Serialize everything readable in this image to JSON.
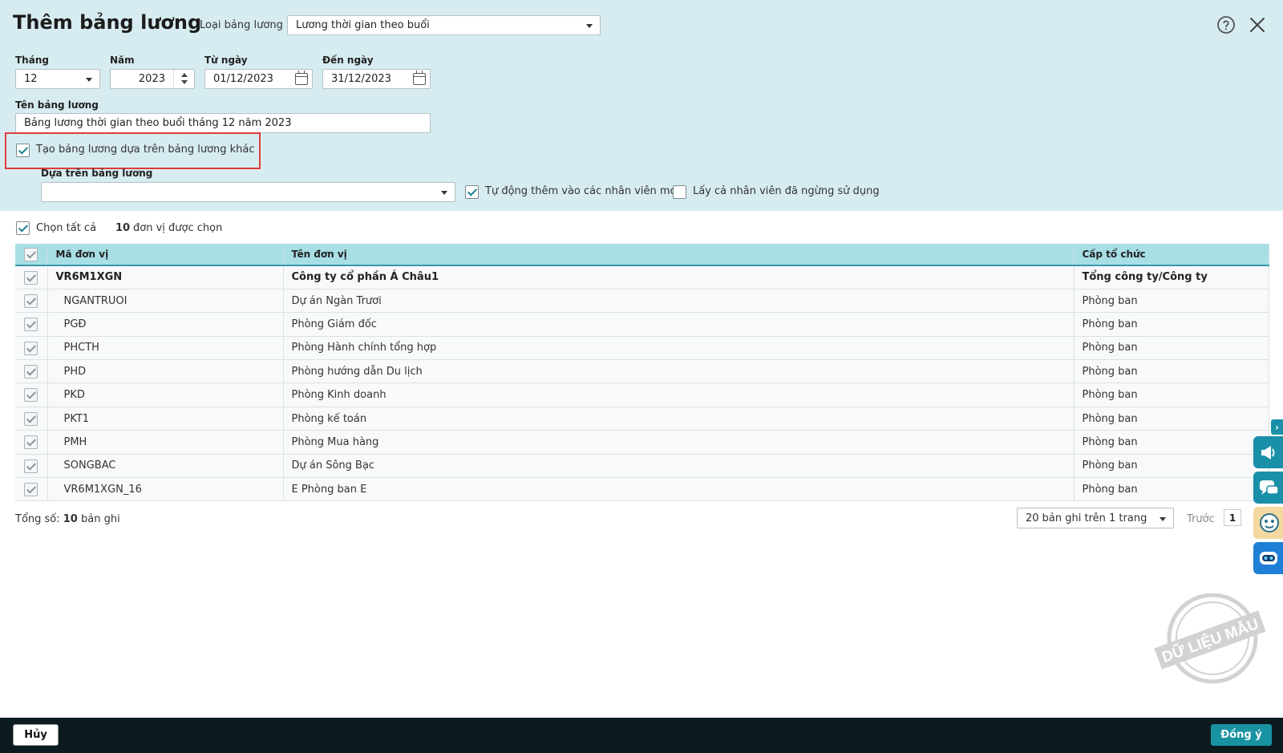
{
  "header": {
    "title": "Thêm bảng lương",
    "payroll_type_label": "Loại bảng lương",
    "payroll_type_value": "Lương thời gian theo buổi"
  },
  "period": {
    "month_label": "Tháng",
    "month_value": "12",
    "year_label": "Năm",
    "year_value": "2023",
    "from_label": "Từ ngày",
    "from_value": "01/12/2023",
    "to_label": "Đến ngày",
    "to_value": "31/12/2023"
  },
  "payroll_name": {
    "label": "Tên bảng lương",
    "value": "Bảng lương thời gian theo buổi tháng 12 năm 2023"
  },
  "options": {
    "based_on_other_label": "Tạo bảng lương dựa trên bảng lương khác",
    "based_on_other_checked": true,
    "based_on_label": "Dựa trên bảng lương",
    "based_on_value": "",
    "auto_add_label": "Tự động thêm vào các nhân viên mới",
    "auto_add_checked": true,
    "include_inactive_label": "Lấy cả nhân viên đã ngừng sử dụng",
    "include_inactive_checked": false
  },
  "selection": {
    "select_all_label": "Chọn tất cả",
    "count": "10",
    "count_suffix": "đơn vị được chọn"
  },
  "table": {
    "columns": [
      "Mã đơn vị",
      "Tên đơn vị",
      "Cấp tổ chức"
    ],
    "rows": [
      {
        "code": "VR6M1XGN",
        "name": "Công ty cổ phần Á Châu1",
        "level": "Tổng công ty/Công ty"
      },
      {
        "code": "NGANTRUOI",
        "name": "Dự án Ngàn Trươi",
        "level": "Phòng ban"
      },
      {
        "code": "PGĐ",
        "name": "Phòng Giám đốc",
        "level": "Phòng ban"
      },
      {
        "code": "PHCTH",
        "name": "Phòng Hành chính tổng hợp",
        "level": "Phòng ban"
      },
      {
        "code": "PHD",
        "name": "Phòng hướng dẫn Du lịch",
        "level": "Phòng ban"
      },
      {
        "code": "PKD",
        "name": "Phòng Kinh doanh",
        "level": "Phòng ban"
      },
      {
        "code": "PKT1",
        "name": "Phòng kế toán",
        "level": "Phòng ban"
      },
      {
        "code": "PMH",
        "name": "Phòng Mua hàng",
        "level": "Phòng ban"
      },
      {
        "code": "SONGBAC",
        "name": "Dự án Sông Bạc",
        "level": "Phòng ban"
      },
      {
        "code": "VR6M1XGN_16",
        "name": "E Phòng ban E",
        "level": "Phòng ban"
      }
    ]
  },
  "pager": {
    "total_prefix": "Tổng số:",
    "total_count": "10",
    "total_suffix": "bản ghi",
    "page_size": "20 bản ghi trên 1 trang",
    "prev_label": "Trước",
    "current_page": "1"
  },
  "watermark": "DỮ LIỆU MẪU",
  "footer": {
    "cancel_label": "Hủy",
    "ok_label": "Đồng ý"
  },
  "colors": {
    "accent": "#1993a2",
    "panel_bg": "#d7ecf0",
    "header_row": "#a7dfe5",
    "highlight": "#e03c3c",
    "footer_bg": "#0b1b1f"
  }
}
